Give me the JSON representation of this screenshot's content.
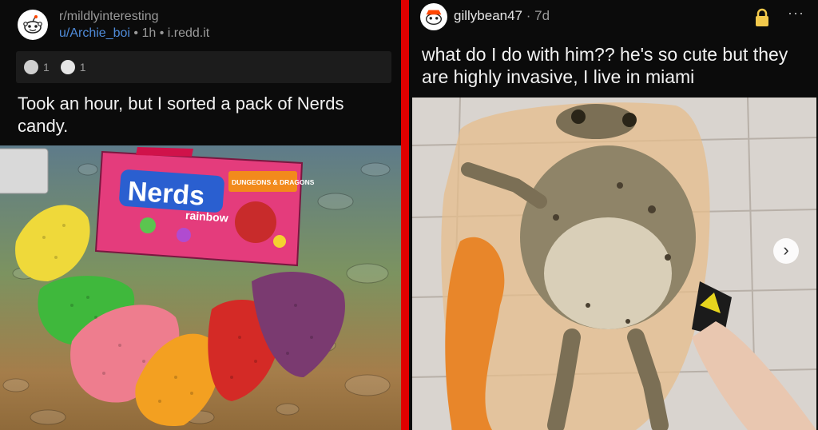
{
  "left_post": {
    "subreddit": "r/mildlyinteresting",
    "username": "u/Archie_boi",
    "age": "1h",
    "domain": "i.redd.it",
    "award_count_1": "1",
    "award_count_2": "1",
    "title": "Took an hour, but I sorted a pack of Nerds candy.",
    "box_brand": "Nerds",
    "box_flavor": "rainbow",
    "box_tag": "DUNGEONS & DRAGONS"
  },
  "right_post": {
    "username": "gillybean47",
    "age": "7d",
    "caption": "what do I do with him?? he's so cute but they are highly invasive, I live in miami",
    "more_glyph": "···",
    "next_glyph": "›"
  },
  "colors": {
    "divider": "#e00000",
    "link": "#4f8bd9",
    "lock": "#f2c94c"
  }
}
